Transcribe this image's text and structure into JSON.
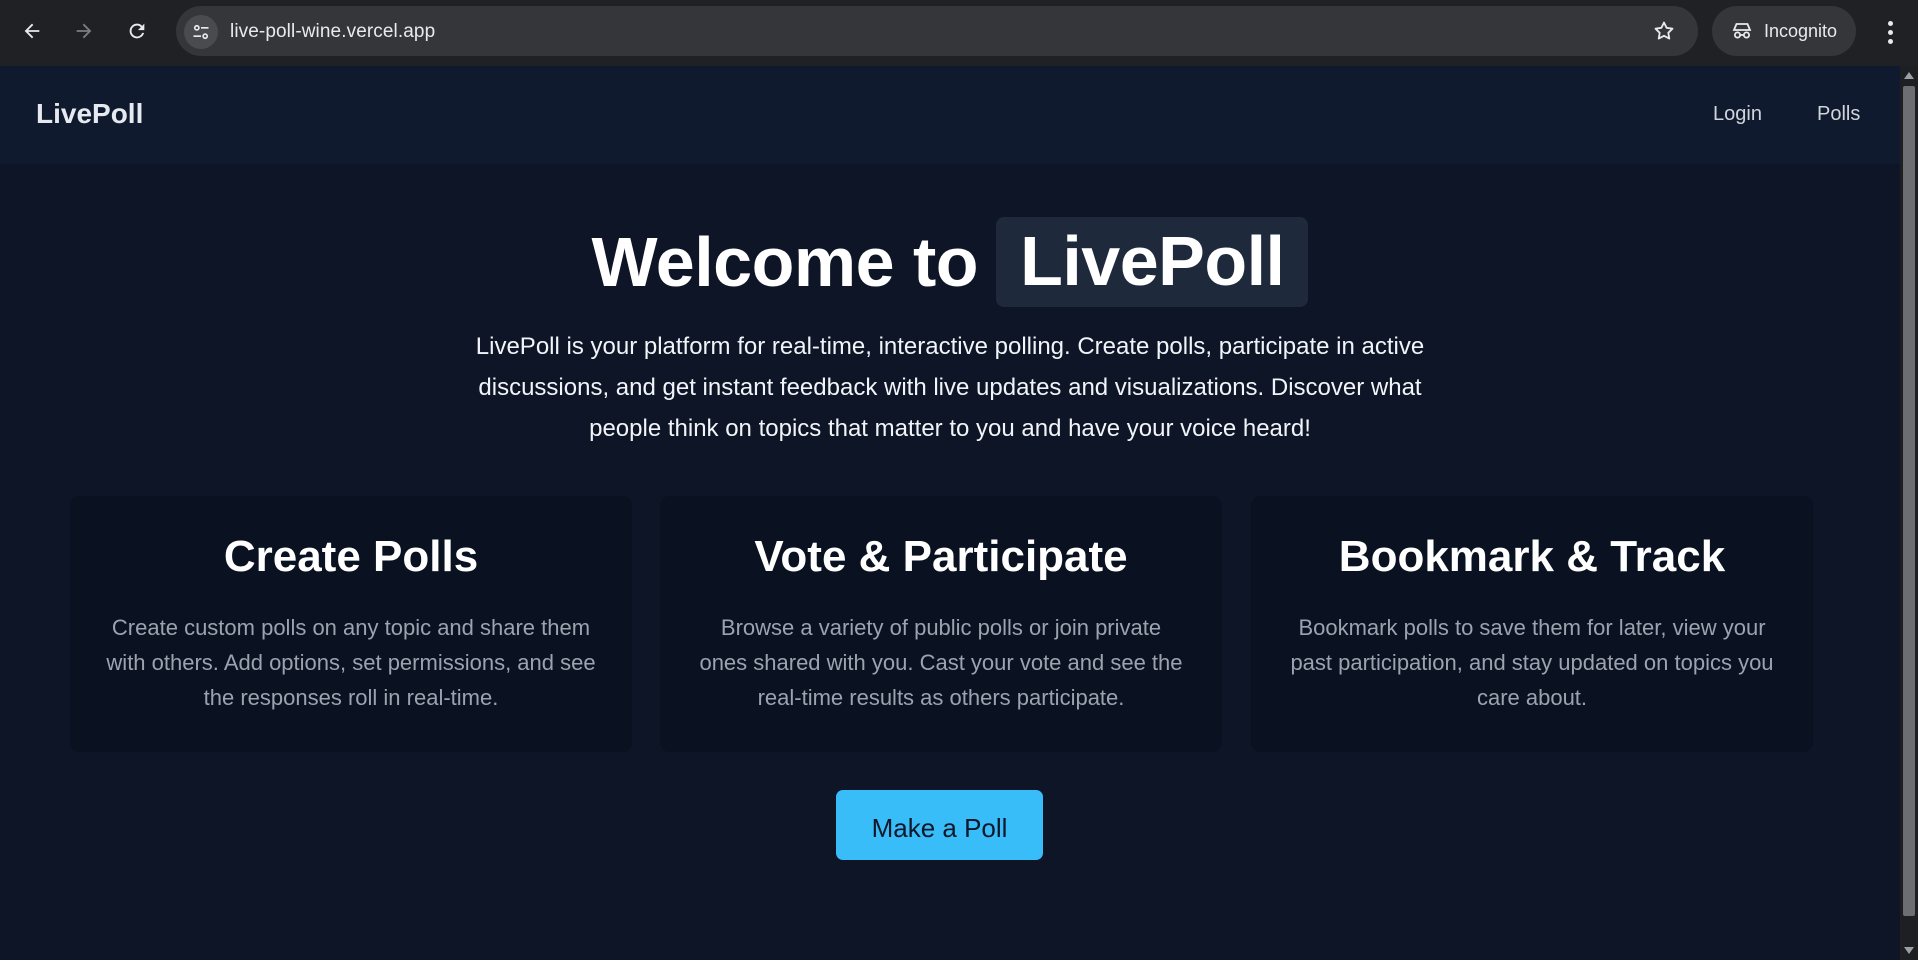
{
  "browser": {
    "url": "live-poll-wine.vercel.app",
    "incognito_label": "Incognito",
    "icons": {
      "back": "arrow-left-icon",
      "forward": "arrow-right-icon",
      "reload": "reload-icon",
      "site_info": "tune-icon",
      "bookmark": "star-icon",
      "incognito": "incognito-icon",
      "menu": "more-vert-icon"
    }
  },
  "app": {
    "brand": "LivePoll",
    "nav": {
      "login": "Login",
      "polls": "Polls"
    },
    "hero": {
      "title_prefix": "Welcome to",
      "title_highlight": "LivePoll",
      "description": "LivePoll is your platform for real-time, interactive polling. Create polls, participate in active discussions, and get instant feedback with live updates and visualizations. Discover what people think on topics that matter to you and have your voice heard!"
    },
    "features": [
      {
        "title": "Create Polls",
        "description": "Create custom polls on any topic and share them with others. Add options, set permissions, and see the responses roll in real-time."
      },
      {
        "title": "Vote & Participate",
        "description": "Browse a variety of public polls or join private ones shared with you. Cast your vote and see the real-time results as others participate."
      },
      {
        "title": "Bookmark & Track",
        "description": "Bookmark polls to save them for later, view your past participation, and stay updated on topics you care about."
      }
    ],
    "cta_label": "Make a Poll"
  },
  "colors": {
    "page_bg": "#0d1526",
    "navbar_bg": "#0f1a2e",
    "card_bg": "#0a1120",
    "highlight_bg": "#1e293b",
    "accent": "#38bdf8"
  }
}
